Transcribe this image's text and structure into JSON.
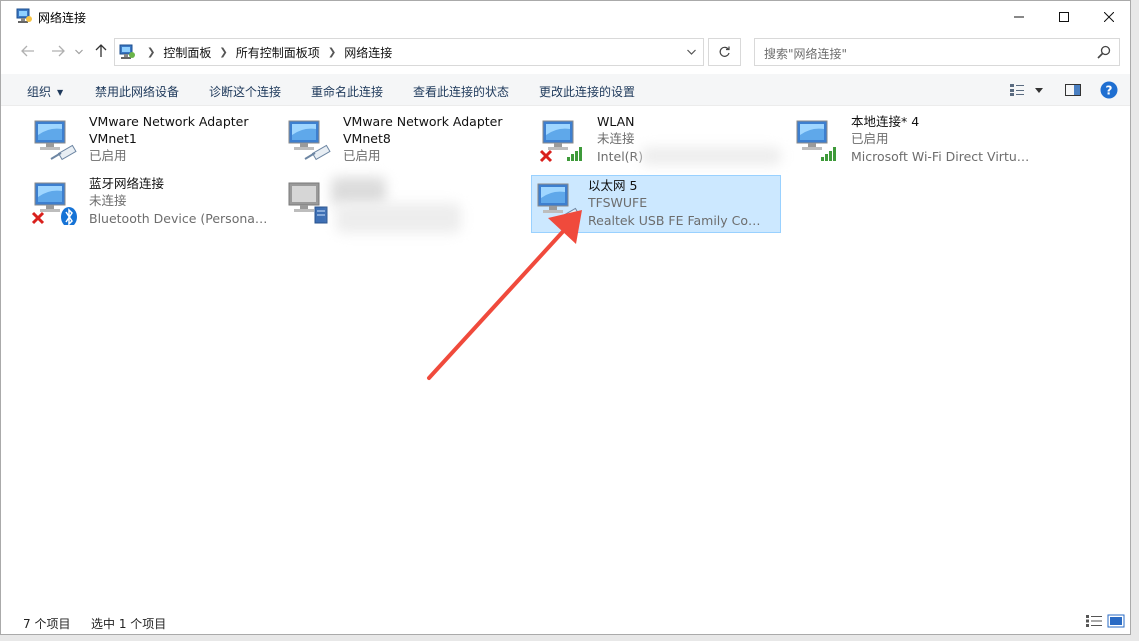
{
  "window": {
    "title": "网络连接"
  },
  "nav": {
    "back_icon": "back-arrow-icon",
    "forward_icon": "forward-arrow-icon",
    "up_icon": "up-arrow-icon",
    "breadcrumbs": [
      "控制面板",
      "所有控制面板项",
      "网络连接"
    ],
    "search_placeholder": "搜索\"网络连接\""
  },
  "toolbar": {
    "organize": "组织",
    "disable": "禁用此网络设备",
    "diagnose": "诊断这个连接",
    "rename": "重命名此连接",
    "view_status": "查看此连接的状态",
    "change_settings": "更改此连接的设置"
  },
  "connections": [
    {
      "name": "VMware Network Adapter",
      "line2": "VMnet1",
      "line3": "已启用",
      "type": "ethernet",
      "status": "enabled",
      "selected": false
    },
    {
      "name": "VMware Network Adapter",
      "line2": "VMnet8",
      "line3": "已启用",
      "type": "ethernet",
      "status": "enabled",
      "selected": false
    },
    {
      "name": "WLAN",
      "line2": "未连接",
      "line3": "Intel(R)",
      "type": "wifi",
      "status": "disconnected",
      "selected": false
    },
    {
      "name": "本地连接* 4",
      "line2": "已启用",
      "line3": "Microsoft Wi-Fi Direct Virtual ...",
      "type": "wifi",
      "status": "enabled",
      "selected": false
    },
    {
      "name": "蓝牙网络连接",
      "line2": "未连接",
      "line3": "Bluetooth Device (Personal Ar...",
      "type": "bluetooth",
      "status": "disconnected",
      "selected": false
    },
    {
      "name": "",
      "line2": "",
      "line3": "",
      "type": "vpn",
      "status": "redacted",
      "selected": false
    },
    {
      "name": "以太网 5",
      "line2": "TFSWUFE",
      "line3": "Realtek USB FE Family Controll...",
      "type": "ethernet",
      "status": "enabled",
      "selected": true
    }
  ],
  "status": {
    "item_count": "7 个项目",
    "selected_count": "选中 1 个项目"
  },
  "colors": {
    "selection_bg": "#cce8ff",
    "selection_border": "#99d1ff",
    "annotation_arrow": "#f04a3c",
    "toolbar_text": "#1e395b"
  }
}
